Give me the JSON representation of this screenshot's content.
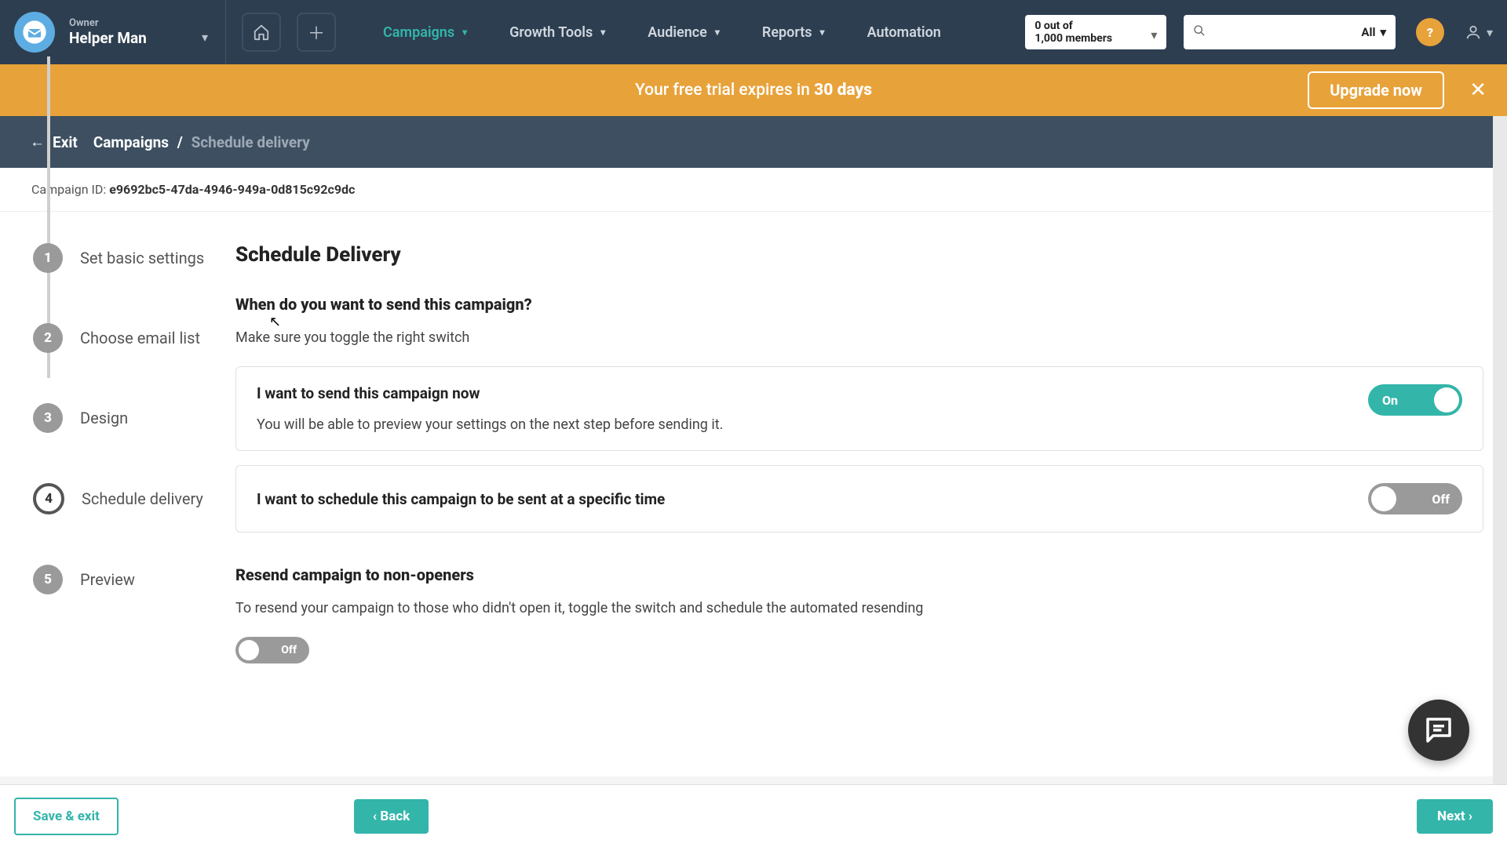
{
  "topnav": {
    "role_label": "Owner",
    "account_name": "Helper Man",
    "links": [
      "Campaigns",
      "Growth Tools",
      "Audience",
      "Reports",
      "Automation"
    ],
    "members_line1": "0 out of",
    "members_line2": "1,000 members",
    "search_filter": "All",
    "help_glyph": "?"
  },
  "trial": {
    "prefix": "Your free trial expires in ",
    "days": "30 days",
    "upgrade_label": "Upgrade now",
    "close_glyph": "✕"
  },
  "crumb": {
    "exit": "Exit",
    "root": "Campaigns",
    "sep": "/",
    "current": "Schedule delivery"
  },
  "campaign": {
    "id_label": "Campaign ID: ",
    "id_value": "e9692bc5-47da-4946-949a-0d815c92c9dc"
  },
  "steps": [
    {
      "num": "1",
      "label": "Set basic settings"
    },
    {
      "num": "2",
      "label": "Choose email list"
    },
    {
      "num": "3",
      "label": "Design"
    },
    {
      "num": "4",
      "label": "Schedule delivery"
    },
    {
      "num": "5",
      "label": "Preview"
    }
  ],
  "content": {
    "page_title": "Schedule Delivery",
    "question": "When do you want to send this campaign?",
    "question_help": "Make sure you toggle the right switch",
    "option_now_title": "I want to send this campaign now",
    "option_now_desc": "You will be able to preview your settings on the next step before sending it.",
    "option_now_state": "On",
    "option_later_title": "I want to schedule this campaign to be sent at a specific time",
    "option_later_state": "Off",
    "resend_title": "Resend campaign to non-openers",
    "resend_desc": "To resend your campaign to those who didn't open it, toggle the switch and schedule the automated resending",
    "resend_state": "Off"
  },
  "footer": {
    "save_exit": "Save & exit",
    "back": "‹ Back",
    "next": "Next ›"
  }
}
